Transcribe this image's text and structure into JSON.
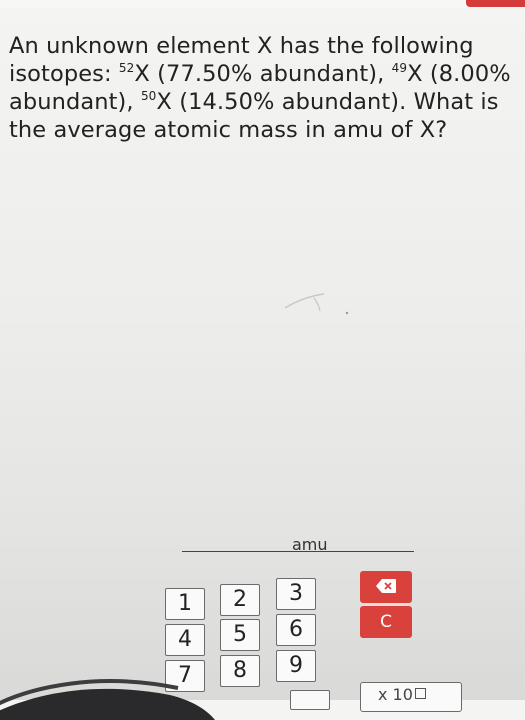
{
  "question": {
    "line1": "An unknown element X has the following",
    "line2_prefix": "isotopes: ",
    "iso1_mass": "52",
    "iso1_text": "X (77.50% abundant), ",
    "iso2_mass": "49",
    "iso2_text": "X (8.00%",
    "line3_prefix": "abundant), ",
    "iso3_mass": "50",
    "iso3_text": "X (14.50% abundant). What is",
    "line4": "the average atomic mass in amu of X?"
  },
  "answer": {
    "unit": "amu"
  },
  "keypad": {
    "keys": [
      "1",
      "2",
      "3",
      "4",
      "5",
      "6",
      "7",
      "8",
      "9"
    ],
    "clear_label": "C",
    "backspace_icon": "backspace-icon",
    "multiplier_label": "x 10"
  },
  "colors": {
    "accent": "#d9413d"
  }
}
